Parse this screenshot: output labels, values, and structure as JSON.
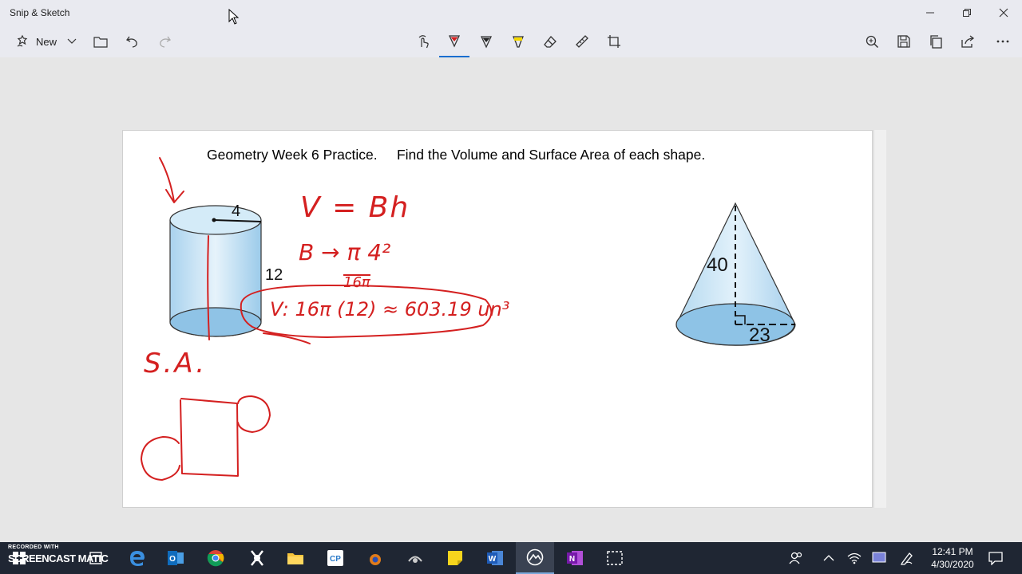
{
  "window": {
    "title": "Snip & Sketch",
    "controls": [
      "minimize",
      "restore",
      "close"
    ]
  },
  "toolbar": {
    "new_label": "New",
    "left_icons": [
      "new-snip-icon",
      "chevron-down-icon",
      "folder-open-icon",
      "undo-icon",
      "redo-icon"
    ],
    "center_icons": [
      "touch-writing-icon",
      "ballpoint-pen-icon",
      "pencil-icon",
      "highlighter-icon",
      "eraser-icon",
      "ruler-icon",
      "crop-icon"
    ],
    "active_tool": "ballpoint-pen",
    "pen_color": "#d42020",
    "right_icons": [
      "zoom-icon",
      "save-icon",
      "copy-icon",
      "share-icon",
      "more-icon"
    ]
  },
  "document": {
    "title": "Geometry Week 6 Practice.     Find the Volume and Surface Area of each shape.",
    "cylinder": {
      "radius_label": "4",
      "height_label": "12"
    },
    "cone": {
      "height_label": "40",
      "radius_label": "23"
    }
  },
  "ink": {
    "color": "#d42020",
    "formula": "V = Bh",
    "base": "B → π 4²",
    "base_value": "16π",
    "result": "V: 16π (12) ≈ 603.19 un³",
    "surface_area_label": "S.A."
  },
  "watermark": {
    "line1": "RECORDED WITH",
    "brand": "SCREENCAST  MATIC"
  },
  "taskbar": {
    "apps": [
      "start-icon",
      "edge-icon",
      "outlook-icon",
      "chrome-icon",
      "app-icon",
      "file-explorer-icon",
      "app-icon",
      "app-icon",
      "app-icon",
      "sticky-notes-icon",
      "word-icon",
      "snip-sketch-icon",
      "onenote-icon",
      "snipping-tool-icon"
    ],
    "active_app": "snip-sketch",
    "time": "12:41 PM",
    "date": "4/30/2020"
  }
}
